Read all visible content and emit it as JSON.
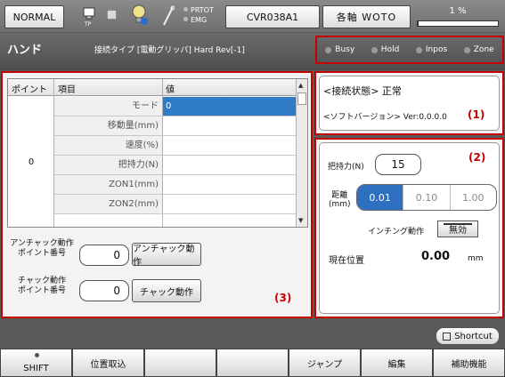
{
  "topbar": {
    "mode": "NORMAL",
    "tp_label": "TP",
    "prtot_label": "PRTOT",
    "emg_label": "EMG",
    "program": "CVR038A1",
    "axis": "各軸 WOTO",
    "override_pct": "1 %",
    "override_fraction": 0.01
  },
  "header": {
    "title": "ハンド",
    "connection_type": "接続タイプ [電動グリッパ] Hard Rev[-1]",
    "leds": [
      "Busy",
      "Hold",
      "Inpos",
      "Zone"
    ]
  },
  "table": {
    "col_point": "ポイント",
    "col_item": "項目",
    "col_value": "値",
    "point": "0",
    "rows": [
      {
        "item": "モード",
        "value": "0"
      },
      {
        "item": "移動量(mm)",
        "value": ""
      },
      {
        "item": "速度(%)",
        "value": ""
      },
      {
        "item": "把持力(N)",
        "value": ""
      },
      {
        "item": "ZON1(mm)",
        "value": ""
      },
      {
        "item": "ZON2(mm)",
        "value": ""
      }
    ]
  },
  "unchuck": {
    "label": "アンチャック動作\nポイント番号",
    "value": "0",
    "button": "アンチャック動作"
  },
  "chuck": {
    "label": "チャック動作\nポイント番号",
    "value": "0",
    "button": "チャック動作"
  },
  "panel_nums": {
    "p1": "(1)",
    "p2": "(2)",
    "p3": "(3)"
  },
  "status": {
    "connection": "<接続状態> 正常",
    "software": "<ソフトバージョン> Ver:0.0.0.0"
  },
  "jog": {
    "grip_label": "把持力(N)",
    "grip_value": "15",
    "distance_label": "距離\n(mm)",
    "distance_options": [
      "0.01",
      "0.10",
      "1.00"
    ],
    "distance_selected": "0.01",
    "inching_label": "インチング動作",
    "inching_state": "無効",
    "position_label": "現在位置",
    "position_value": "0.00",
    "position_unit": "mm"
  },
  "shortcut_label": "Shortcut",
  "function_keys": [
    "SHIFT",
    "位置取込",
    "",
    "",
    "ジャンプ",
    "編集",
    "補助機能"
  ]
}
